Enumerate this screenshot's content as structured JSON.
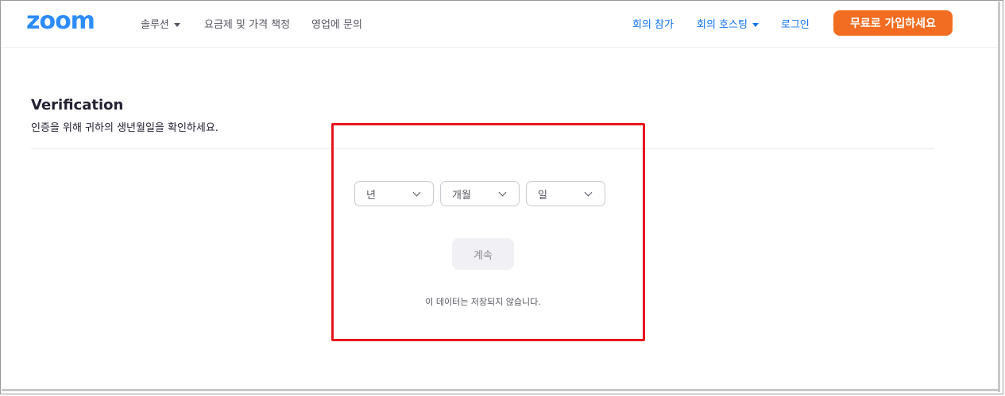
{
  "header": {
    "logo": "zoom",
    "nav_left": [
      "솔루션",
      "요금제 및 가격 책정",
      "영업에 문의"
    ],
    "nav_right": [
      "회의 참가",
      "회의 호스팅",
      "로그인"
    ],
    "signup_label": "무료로 가입하세요"
  },
  "verification": {
    "title": "Verification",
    "subtitle": "인증을 위해 귀하의 생년월일을 확인하세요.",
    "selects": {
      "year": "년",
      "month": "개월",
      "day": "일"
    },
    "continue_label": "계속",
    "note": "이 데이터는 저장되지 않습니다."
  },
  "colors": {
    "brand_blue": "#2d8cff",
    "link_blue": "#0e72ed",
    "signup_orange": "#f26d21",
    "highlight_red": "#e8151e"
  }
}
